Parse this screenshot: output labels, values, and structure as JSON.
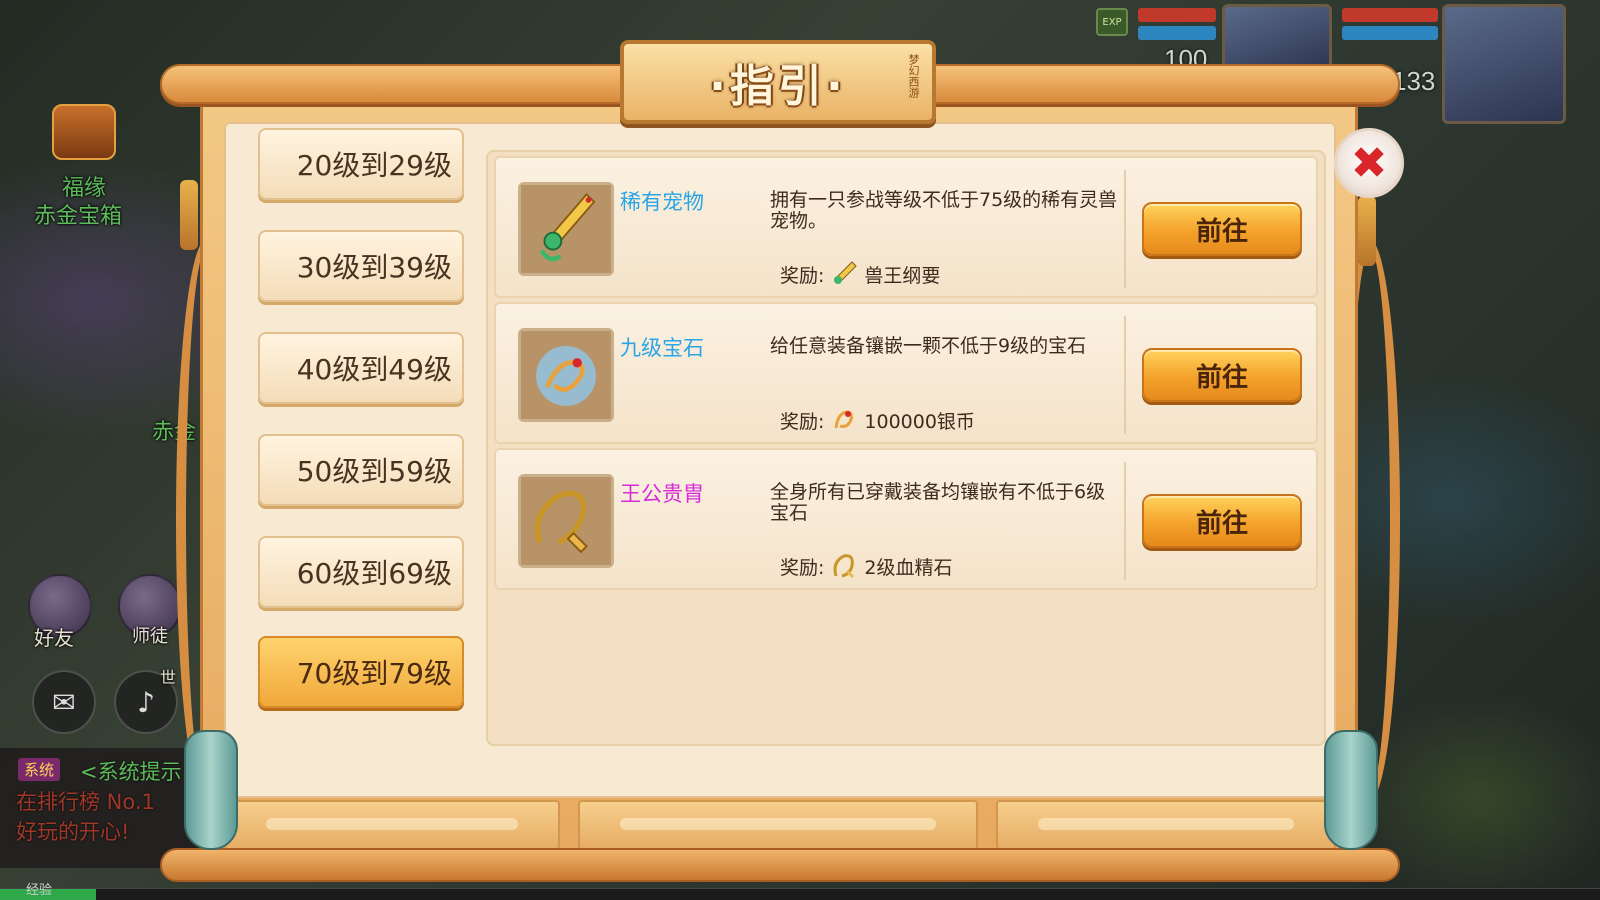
{
  "hud": {
    "exp_label": "EXP",
    "player_value": "100",
    "pet_value": "133"
  },
  "left_side": {
    "chest_title": "福缘",
    "chest_subtitle": "赤金宝箱",
    "partial_label": "赤金",
    "friends_label": "好友",
    "mentor_label": "师徒",
    "world_label": "世"
  },
  "system_log": {
    "tag": "系统",
    "line1": "<系统提示",
    "line2": "在排行榜 No.1",
    "line3": "好玩的开心!"
  },
  "exp_bar": {
    "label": "经验",
    "progress": 0.06
  },
  "dialog": {
    "title": "·指引·",
    "seal_text": "梦幻西游",
    "close_glyph": "✖"
  },
  "level_tabs": [
    {
      "label": "20级到29级",
      "active": false
    },
    {
      "label": "30级到39级",
      "active": false
    },
    {
      "label": "40级到49级",
      "active": false
    },
    {
      "label": "50级到59级",
      "active": false
    },
    {
      "label": "60级到69级",
      "active": false
    },
    {
      "label": "70级到79级",
      "active": true
    }
  ],
  "quests": [
    {
      "name": "稀有宠物",
      "name_color": "#2aa5e6",
      "icon": "jade-sword-icon",
      "description": "拥有一只参战等级不低于75级的稀有灵兽宠物。",
      "reward_label": "奖励:",
      "reward_icon": "sword-reward-icon",
      "reward_text": "兽王纲要",
      "button": "前往"
    },
    {
      "name": "九级宝石",
      "name_color": "#2aa5e6",
      "icon": "gem-charm-icon",
      "description": "给任意装备镶嵌一颗不低于9级的宝石",
      "reward_label": "奖励:",
      "reward_icon": "silver-coin-icon",
      "reward_text": "100000银币",
      "button": "前往"
    },
    {
      "name": "王公贵胄",
      "name_color": "#d52cd8",
      "icon": "gold-whip-icon",
      "description": "全身所有已穿戴装备均镶嵌有不低于6级宝石",
      "reward_label": "奖励:",
      "reward_icon": "blood-stone-icon",
      "reward_text": "2级血精石",
      "button": "前往"
    }
  ],
  "colors": {
    "panel_bg": "#f7e9d2",
    "frame_orange": "#e7a95e",
    "active_tab": "#f0a83a",
    "button_orange": "#f4a22c",
    "close_red": "#d8262a"
  }
}
